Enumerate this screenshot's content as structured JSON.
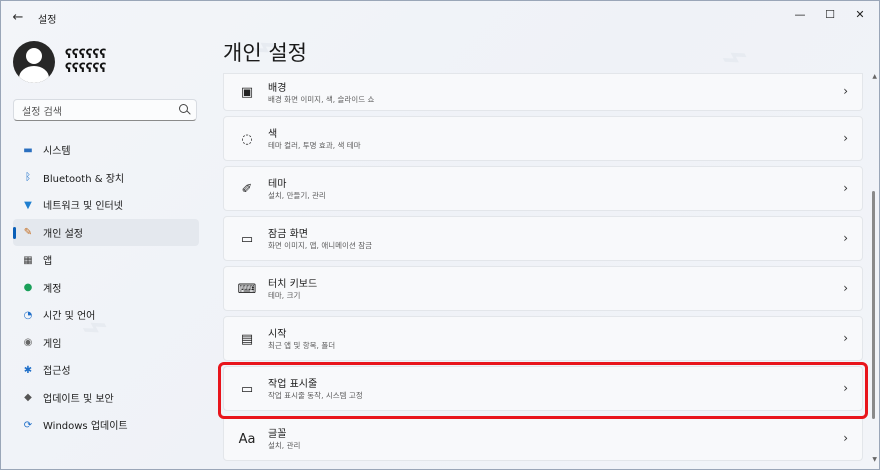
{
  "window": {
    "title": "설정",
    "back_glyph": "←",
    "minimize_glyph": "—",
    "maximize_glyph": "☐",
    "close_glyph": "✕"
  },
  "user": {
    "name_line1": "ʕʕʕʕʕʕ",
    "name_line2": "ʕʕʕʕʕʕ"
  },
  "search": {
    "placeholder": "설정 검색"
  },
  "sidebar": {
    "items": [
      {
        "label": "시스템",
        "icon": "monitor-icon",
        "glyph": "▬",
        "color": "#2b6fbf"
      },
      {
        "label": "Bluetooth & 장치",
        "icon": "bluetooth-icon",
        "glyph": "ᛒ",
        "color": "#1f6fc9"
      },
      {
        "label": "네트워크 및 인터넷",
        "icon": "wifi-icon",
        "glyph": "▼",
        "color": "#1f7fd0"
      },
      {
        "label": "개인 설정",
        "icon": "brush-icon",
        "glyph": "✎",
        "color": "#c46a1a"
      },
      {
        "label": "앱",
        "icon": "apps-icon",
        "glyph": "▦",
        "color": "#444444"
      },
      {
        "label": "계정",
        "icon": "account-icon",
        "glyph": "●",
        "color": "#1aa05a"
      },
      {
        "label": "시간 및 언어",
        "icon": "globe-clock-icon",
        "glyph": "◔",
        "color": "#1f6fc9"
      },
      {
        "label": "게임",
        "icon": "gamepad-icon",
        "glyph": "◉",
        "color": "#666666"
      },
      {
        "label": "접근성",
        "icon": "accessibility-icon",
        "glyph": "✱",
        "color": "#1f6fc9"
      },
      {
        "label": "업데이트 및 보안",
        "icon": "shield-icon",
        "glyph": "◆",
        "color": "#555555"
      },
      {
        "label": "Windows 업데이트",
        "icon": "update-icon",
        "glyph": "⟳",
        "color": "#1f6fc9"
      }
    ],
    "active_index": 3
  },
  "main": {
    "title": "개인 설정",
    "cards": [
      {
        "title": "배경",
        "subtitle": "배경 화면 이미지, 색, 슬라이드 쇼",
        "icon": "image-icon",
        "glyph": "▣"
      },
      {
        "title": "색",
        "subtitle": "테마 컬러, 투명 효과, 색 테마",
        "icon": "palette-icon",
        "glyph": "◌"
      },
      {
        "title": "테마",
        "subtitle": "설치, 만들기, 관리",
        "icon": "brush-icon",
        "glyph": "✐"
      },
      {
        "title": "잠금 화면",
        "subtitle": "화면 이미지, 앱, 애니메이션 잠금",
        "icon": "lock-screen-icon",
        "glyph": "▭"
      },
      {
        "title": "터치 키보드",
        "subtitle": "테마, 크기",
        "icon": "keyboard-icon",
        "glyph": "⌨"
      },
      {
        "title": "시작",
        "subtitle": "최근 앱 및 항목, 폴더",
        "icon": "start-icon",
        "glyph": "▤"
      },
      {
        "title": "작업 표시줄",
        "subtitle": "작업 표시줄 동작, 시스템 고정",
        "icon": "taskbar-icon",
        "glyph": "▭"
      },
      {
        "title": "글꼴",
        "subtitle": "설치, 관리",
        "icon": "fonts-icon",
        "glyph": "Aa"
      }
    ],
    "chevron": "›"
  },
  "highlight_color": "#e8141b",
  "accent_color": "#0a5fb8"
}
